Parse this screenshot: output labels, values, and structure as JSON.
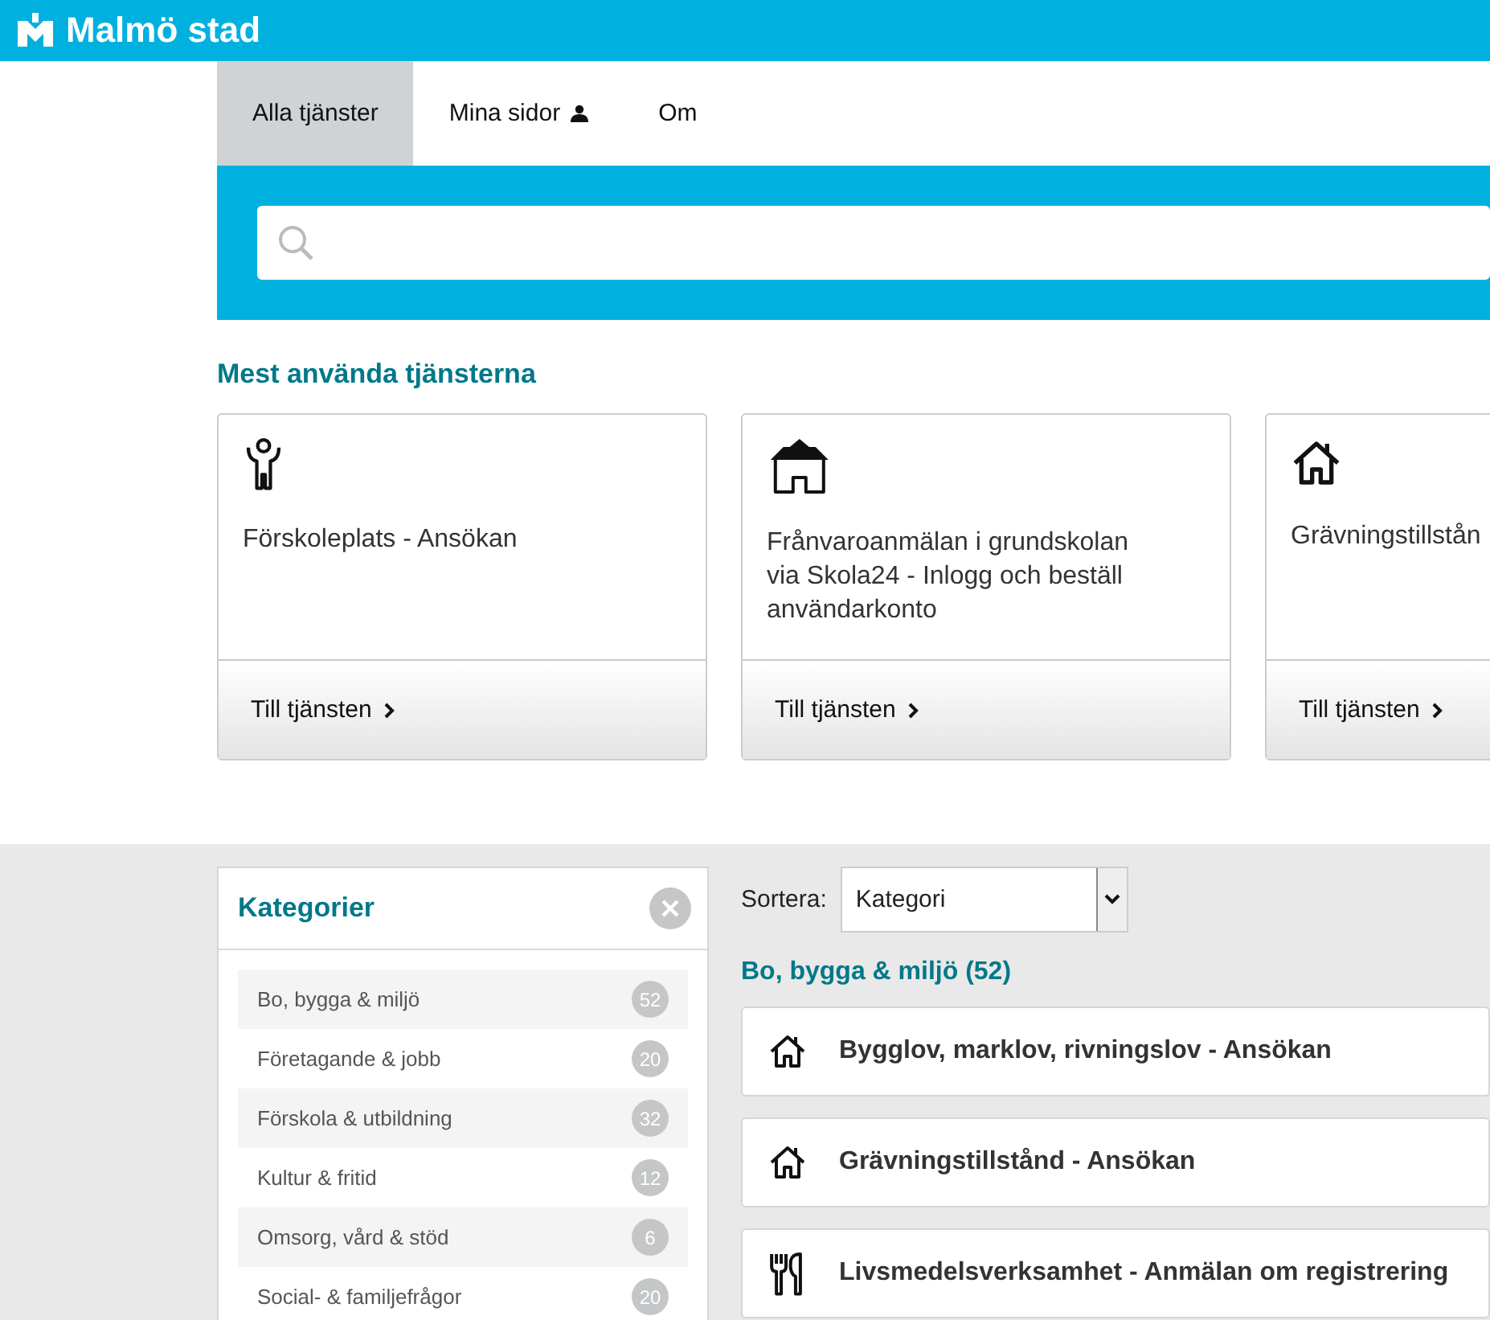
{
  "header": {
    "logo_text": "Malmö stad"
  },
  "tabs": [
    {
      "label": "Alla tjänster",
      "selected": true,
      "kind": "plain"
    },
    {
      "label": "Mina sidor",
      "selected": false,
      "kind": "account"
    },
    {
      "label": "Om",
      "selected": false,
      "kind": "plain"
    }
  ],
  "popular": {
    "title": "Mest använda tjänsterna",
    "cards": [
      {
        "kind": "child",
        "title": "Förskoleplats - Ansökan",
        "button": "Till tjänsten"
      },
      {
        "kind": "school",
        "title": "Frånvaroanmälan i grundskolan via Skola24 - Inlogg och beställ användarkonto",
        "button": "Till tjänsten"
      },
      {
        "kind": "house",
        "title": "Grävningstillstån",
        "button": "Till tjänsten"
      }
    ]
  },
  "categories": {
    "title": "Kategorier",
    "items": [
      {
        "name": "Bo, bygga & miljö",
        "count": "52"
      },
      {
        "name": "Företagande & jobb",
        "count": "20"
      },
      {
        "name": "Förskola & utbildning",
        "count": "32"
      },
      {
        "name": "Kultur & fritid",
        "count": "12"
      },
      {
        "name": "Omsorg, vård & stöd",
        "count": "6"
      },
      {
        "name": "Social- & familjefrågor",
        "count": "20"
      }
    ]
  },
  "sort": {
    "label": "Sortera:",
    "value": "Kategori"
  },
  "results": {
    "heading": "Bo, bygga & miljö (52)",
    "items": [
      {
        "kind": "house",
        "title": "Bygglov, marklov, rivningslov - Ansökan"
      },
      {
        "kind": "house",
        "title": "Grävningstillstånd - Ansökan"
      },
      {
        "kind": "food",
        "title": "Livsmedelsverksamhet - Anmälan om registrering"
      }
    ]
  }
}
